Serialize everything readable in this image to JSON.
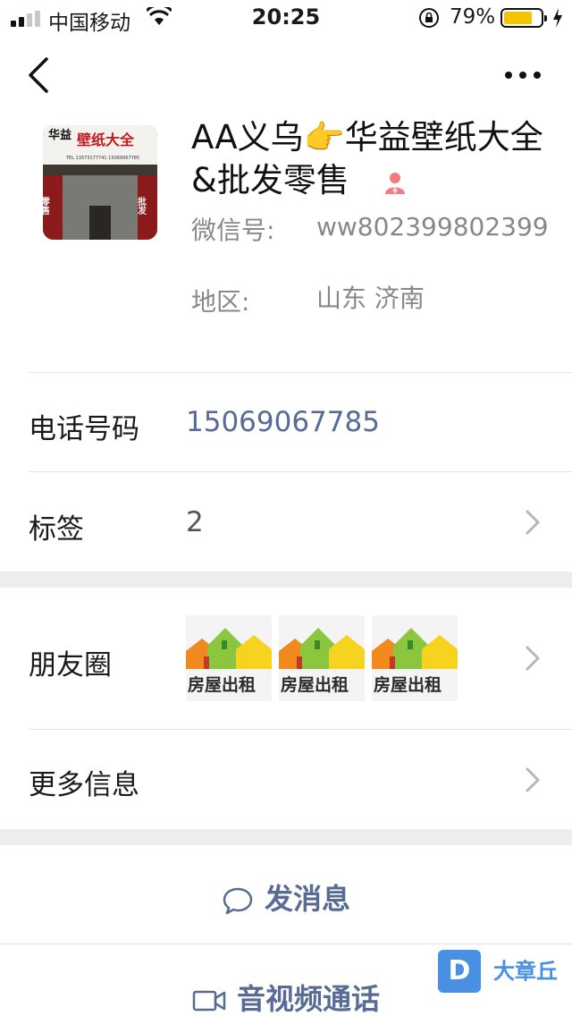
{
  "status_bar": {
    "carrier": "中国移动",
    "time": "20:25",
    "battery_percent": "79%",
    "battery_level": 0.79,
    "signal_bars": 2,
    "icons": [
      "signal-icon",
      "wifi-icon",
      "orientation-lock-icon",
      "battery-icon",
      "charging-icon"
    ]
  },
  "nav": {
    "back_icon": "chevron-left-icon",
    "more_icon": "more-dots-icon"
  },
  "profile": {
    "name": "AA义乌👉华益壁纸大全 &批发零售",
    "gender_icon": "female-icon",
    "gender_color": "#f37b7b",
    "avatar": {
      "sign_text": "壁纸大全",
      "side_text": "华益",
      "phone_line": "TEL 13573177741  15069067785",
      "left_text": "零售",
      "right_text": "批发"
    },
    "wechat_id_label": "微信号:",
    "wechat_id": "ww802399802399",
    "region_label": "地区:",
    "region": "山东 济南"
  },
  "rows": {
    "phone_label": "电话号码",
    "phone_value": "15069067785",
    "tags_label": "标签",
    "tags_value": "2",
    "moments_label": "朋友圈",
    "moments_thumb_text": "房屋出租",
    "moments_count": 3,
    "more_label": "更多信息"
  },
  "actions": {
    "message_label": "发消息",
    "call_label": "音视频通话"
  },
  "watermark": {
    "logo_letter": "D",
    "text": "大章丘"
  },
  "colors": {
    "link_blue": "#576b95",
    "battery_yellow": "#f5c400",
    "gap_gray": "#ededed"
  }
}
